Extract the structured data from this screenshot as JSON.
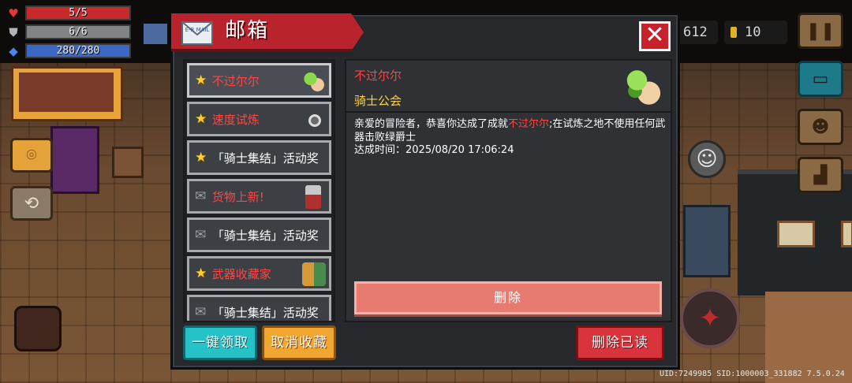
{
  "player": {
    "hp": "5/5",
    "armor": "6/6",
    "energy": "280/280",
    "hp_fraction": 1.0,
    "armor_fraction": 1.0,
    "energy_fraction": 1.0
  },
  "hud": {
    "gems": "612",
    "coins": "10",
    "uid_line": "UID:7249985 SID:1000003_331882 7.5.0.24"
  },
  "icons": {
    "hp": "heart-icon",
    "armor": "shield-icon",
    "energy": "energy-crystal-icon",
    "mail": "mail-envelope-icon",
    "close": "close-icon",
    "star": "star-icon",
    "read": "opened-envelope-icon",
    "pause": "pause-icon",
    "chat": "chat-icon",
    "profile": "profile-card-icon",
    "stairs": "stairs-icon",
    "map": "map-pin-icon",
    "swap": "swap-icon",
    "emote": "smile-icon",
    "attack": "attack-icon"
  },
  "colors": {
    "title_banner": "#b8232e",
    "highlight_red": "#ff4444",
    "sender_yellow": "#ffd23e",
    "claim_button": "#25c2c8",
    "unfavorite_button": "#f1a630",
    "delete_read_button": "#d9343c",
    "delete_button": "#e87b70"
  },
  "mailbox": {
    "title": "邮箱",
    "mail_icon_text": "E-R MAIL",
    "items": [
      {
        "label": "不过尔尔",
        "starred": true,
        "label_red": true,
        "selected": true
      },
      {
        "label": "速度试炼",
        "starred": true,
        "label_red": true,
        "selected": false
      },
      {
        "label": "「骑士集结」活动奖",
        "starred": true,
        "label_red": false,
        "selected": false
      },
      {
        "label": "货物上新!",
        "starred": false,
        "label_red": true,
        "selected": false
      },
      {
        "label": "「骑士集结」活动奖",
        "starred": false,
        "label_red": false,
        "selected": false
      },
      {
        "label": "武器收藏家",
        "starred": true,
        "label_red": true,
        "selected": false
      },
      {
        "label": "「骑士集结」活动奖",
        "starred": false,
        "label_red": false,
        "selected": false
      }
    ],
    "detail": {
      "title": "不过尔尔",
      "sender": "骑士公会",
      "body_prefix": "亲爱的冒险者，恭喜你达成了成就",
      "body_highlight": "不过尔尔",
      "body_suffix": ";在试炼之地不使用任何武器击败绿爵士",
      "time_label": "达成时间：",
      "time_value": "2025/08/20 17:06:24",
      "delete_label": "删除"
    },
    "buttons": {
      "claim_all": "一键领取",
      "unfavorite": "取消收藏",
      "delete_read": "删除已读",
      "close": "✕"
    }
  }
}
